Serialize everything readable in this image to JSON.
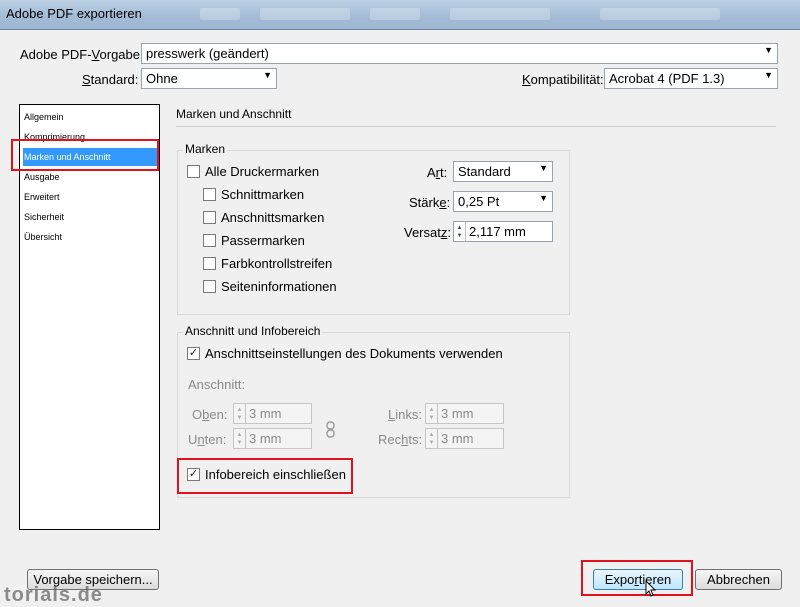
{
  "window": {
    "title": "Adobe PDF exportieren"
  },
  "top": {
    "preset_label_pre": "Adobe PDF-",
    "preset_label_u": "V",
    "preset_label_post": "orgabe:",
    "preset_value": "presswerk (geändert)",
    "standard_label_u": "S",
    "standard_label_post": "tandard:",
    "standard_value": "Ohne",
    "compat_label_u": "K",
    "compat_label_post": "ompatibilität:",
    "compat_value": "Acrobat 4 (PDF 1.3)"
  },
  "sidebar": {
    "items": [
      {
        "label": "Allgemein"
      },
      {
        "label": "Komprimierung"
      },
      {
        "label": "Marken und Anschnitt"
      },
      {
        "label": "Ausgabe"
      },
      {
        "label": "Erweitert"
      },
      {
        "label": "Sicherheit"
      },
      {
        "label": "Übersicht"
      }
    ]
  },
  "panel": {
    "title": "Marken und Anschnitt",
    "marks": {
      "title": "Marken",
      "all_marks": {
        "label": "Alle Druckermarken",
        "checked": false
      },
      "sub_marks": [
        {
          "label": "Schnittmarken",
          "checked": false
        },
        {
          "label": "Anschnittsmarken",
          "checked": false
        },
        {
          "label": "Passermarken",
          "checked": false
        },
        {
          "label": "Farbkontrollstreifen",
          "checked": false
        },
        {
          "label": "Seiteninformationen",
          "checked": false
        }
      ],
      "type_label_pre": "A",
      "type_label_u": "r",
      "type_label_post": "t:",
      "type_value": "Standard",
      "weight_label_pre": "Stärk",
      "weight_label_u": "e",
      "weight_label_post": ":",
      "weight_value": "0,25 Pt",
      "offset_label_pre": "Versat",
      "offset_label_u": "z",
      "offset_label_post": ":",
      "offset_value": "2,117 mm"
    },
    "bleed": {
      "title": "Anschnitt und Infobereich",
      "use_doc": {
        "label": "Anschnittseinstellungen des Dokuments verwenden",
        "checked": true
      },
      "bleed_label": "Anschnitt:",
      "top_label_pre": "O",
      "top_label_u": "b",
      "top_label_post": "en:",
      "top_value": "3 mm",
      "bottom_label_pre": "U",
      "bottom_label_u": "n",
      "bottom_label_post": "ten:",
      "bottom_value": "3 mm",
      "left_label_pre": "L",
      "left_label_u": "i",
      "left_label_post": "nks:",
      "left_value": "3 mm",
      "right_label_pre": "Rec",
      "right_label_u": "h",
      "right_label_post": "ts:",
      "right_value": "3 mm",
      "slug": {
        "label": "Infobereich einschließen",
        "checked": true
      }
    }
  },
  "footer": {
    "save_preset": "Vorgabe speichern...",
    "export_pre": "Expo",
    "export_u": "r",
    "export_post": "tieren",
    "cancel": "Abbrechen"
  },
  "watermark": "torials.de",
  "colors": {
    "highlight": "#e1121d",
    "selection": "#3399ff"
  }
}
